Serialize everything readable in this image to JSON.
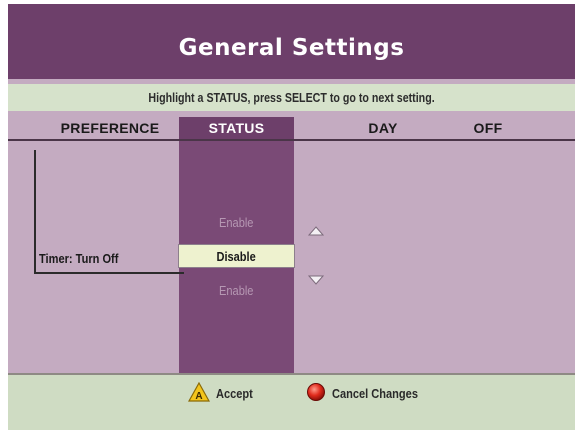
{
  "title": "General Settings",
  "hint": "Highlight a STATUS, press SELECT to go to next setting.",
  "columns": {
    "preference": "PREFERENCE",
    "status": "STATUS",
    "day": "DAY",
    "off": "OFF"
  },
  "row": {
    "preference_label": "Timer: Turn Off",
    "option_above": "Enable",
    "option_selected": "Disable",
    "option_below": "Enable"
  },
  "footer": {
    "accept_label": "Accept",
    "cancel_label": "Cancel Changes"
  },
  "icons": {
    "scroll_up": "triangle-up-icon",
    "scroll_down": "triangle-down-icon",
    "accept": "yellow-triangle-a-icon",
    "cancel": "red-circle-icon"
  },
  "colors": {
    "title_bar": "#6d3f6a",
    "background": "#c4abc1",
    "hint_bar": "#d6e2cb",
    "status_column": "#7a4a76",
    "selected_option": "#eef2cf",
    "footer": "#cfdcc3"
  }
}
